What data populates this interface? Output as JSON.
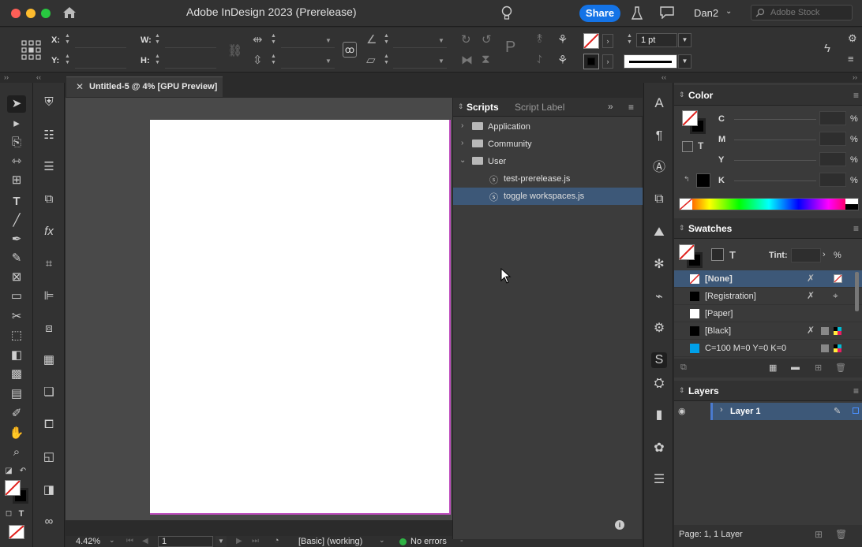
{
  "titlebar": {
    "title": "Adobe InDesign 2023 (Prerelease)",
    "share_label": "Share",
    "user_name": "Dan2",
    "search_placeholder": "Adobe Stock"
  },
  "controlbar": {
    "x_label": "X:",
    "y_label": "Y:",
    "w_label": "W:",
    "h_label": "H:",
    "stroke_weight": "1 pt"
  },
  "document_tab": {
    "label": "Untitled-5 @ 4% [GPU Preview]"
  },
  "scripts_panel": {
    "tabs": [
      "Scripts",
      "Script Label"
    ],
    "tree": [
      {
        "label": "Application",
        "type": "folder",
        "expanded": false
      },
      {
        "label": "Community",
        "type": "folder",
        "expanded": false
      },
      {
        "label": "User",
        "type": "folder",
        "expanded": true
      },
      {
        "label": "test-prerelease.js",
        "type": "script"
      },
      {
        "label": "toggle workspaces.js",
        "type": "script",
        "selected": true
      }
    ]
  },
  "color_panel": {
    "title": "Color",
    "channels": [
      {
        "label": "C",
        "unit": "%"
      },
      {
        "label": "M",
        "unit": "%"
      },
      {
        "label": "Y",
        "unit": "%"
      },
      {
        "label": "K",
        "unit": "%"
      }
    ]
  },
  "swatches_panel": {
    "title": "Swatches",
    "tint_label": "Tint:",
    "tint_unit": "%",
    "items": [
      {
        "label": "[None]",
        "color": "none",
        "selected": true
      },
      {
        "label": "[Registration]",
        "color": "#000000"
      },
      {
        "label": "[Paper]",
        "color": "#ffffff"
      },
      {
        "label": "[Black]",
        "color": "#000000"
      },
      {
        "label": "C=100 M=0 Y=0 K=0",
        "color": "#00a0e9"
      }
    ]
  },
  "layers_panel": {
    "title": "Layers",
    "layers": [
      {
        "label": "Layer 1",
        "selected": true
      }
    ],
    "status": "Page: 1, 1 Layer"
  },
  "statusbar": {
    "zoom": "4.42%",
    "page": "1",
    "profile": "[Basic] (working)",
    "preflight": "No errors"
  },
  "colors": {
    "accent": "#1473e6",
    "selection": "#3d5878",
    "ok_green": "#2fb344"
  }
}
